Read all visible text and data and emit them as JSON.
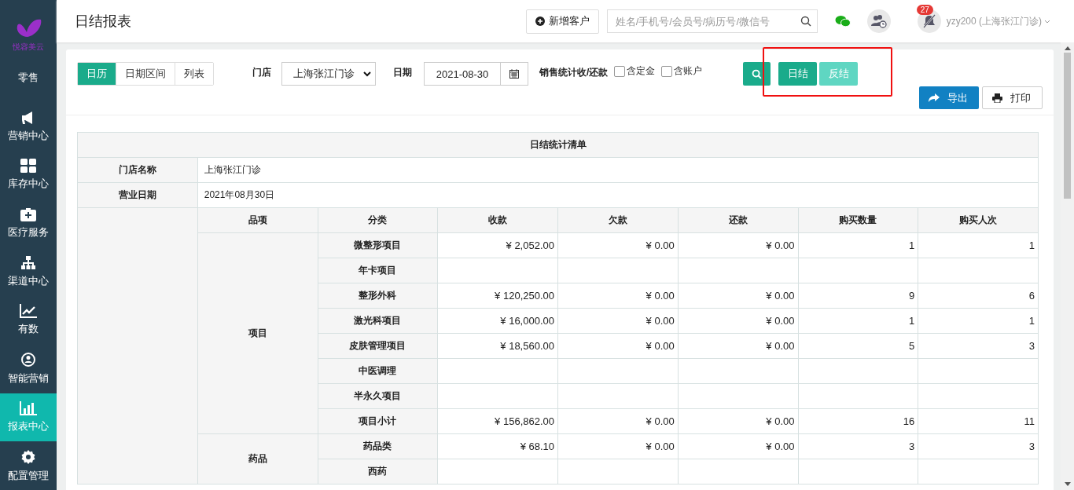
{
  "sidebar": {
    "logo_text": "悦容美云",
    "items": [
      {
        "label": "零售",
        "selected": false
      },
      {
        "label": "营销中心",
        "selected": false
      },
      {
        "label": "库存中心",
        "selected": false
      },
      {
        "label": "医疗服务",
        "selected": false
      },
      {
        "label": "渠道中心",
        "selected": false
      },
      {
        "label": "有数",
        "selected": false
      },
      {
        "label": "智能营销",
        "selected": false
      },
      {
        "label": "报表中心",
        "selected": true
      },
      {
        "label": "配置管理",
        "selected": false
      }
    ]
  },
  "header": {
    "title": "日结报表",
    "new_customer": "新增客户",
    "search": {
      "placeholder": "姓名/手机号/会员号/病历号/微信号"
    },
    "notification_count": "27",
    "user": "yzy200 (上海张江门诊)"
  },
  "filters": {
    "view_tabs": [
      {
        "label": "日历",
        "selected": true
      },
      {
        "label": "日期区间",
        "selected": false
      },
      {
        "label": "列表",
        "selected": false
      }
    ],
    "store_label": "门店",
    "store_value": "上海张江门诊",
    "date_label": "日期",
    "date_value": "2021-08-30",
    "sales_label": "销售统计收/还款",
    "checkboxes": [
      {
        "label": "含定金",
        "checked": false
      },
      {
        "label": "含账户",
        "checked": false
      }
    ],
    "actions": [
      {
        "label": "日结",
        "disabled": false
      },
      {
        "label": "反结",
        "disabled": true
      }
    ],
    "highlighted": true,
    "export": "导出",
    "print": "打印"
  },
  "report": {
    "title": "日结统计清单",
    "store_name_label": "门店名称",
    "store_name": "上海张江门诊",
    "date_label": "营业日期",
    "date": "2021年08月30日",
    "columns": [
      "品项",
      "分类",
      "收款",
      "欠款",
      "还款",
      "购买数量",
      "购买人次"
    ],
    "groups": [
      {
        "label": "项目",
        "rows": [
          {
            "category": "微整形项目",
            "receipts": "¥ 2,052.00",
            "arrears": "¥ 0.00",
            "repayment": "¥ 0.00",
            "quantity": "1",
            "buyers": "1"
          },
          {
            "category": "年卡项目"
          },
          {
            "category": "整形外科",
            "receipts": "¥ 120,250.00",
            "arrears": "¥ 0.00",
            "repayment": "¥ 0.00",
            "quantity": "9",
            "buyers": "6"
          },
          {
            "category": "激光科项目",
            "receipts": "¥ 16,000.00",
            "arrears": "¥ 0.00",
            "repayment": "¥ 0.00",
            "quantity": "1",
            "buyers": "1"
          },
          {
            "category": "皮肤管理项目",
            "receipts": "¥ 18,560.00",
            "arrears": "¥ 0.00",
            "repayment": "¥ 0.00",
            "quantity": "5",
            "buyers": "3"
          },
          {
            "category": "中医调理"
          },
          {
            "category": "半永久项目"
          },
          {
            "category": "项目小计",
            "receipts": "¥ 156,862.00",
            "arrears": "¥ 0.00",
            "repayment": "¥ 0.00",
            "quantity": "16",
            "buyers": "11"
          }
        ]
      },
      {
        "label": "药品",
        "rows": [
          {
            "category": "药品类",
            "receipts": "¥ 68.10",
            "arrears": "¥ 0.00",
            "repayment": "¥ 0.00",
            "quantity": "3",
            "buyers": "3"
          },
          {
            "category": "西药"
          }
        ]
      }
    ]
  }
}
